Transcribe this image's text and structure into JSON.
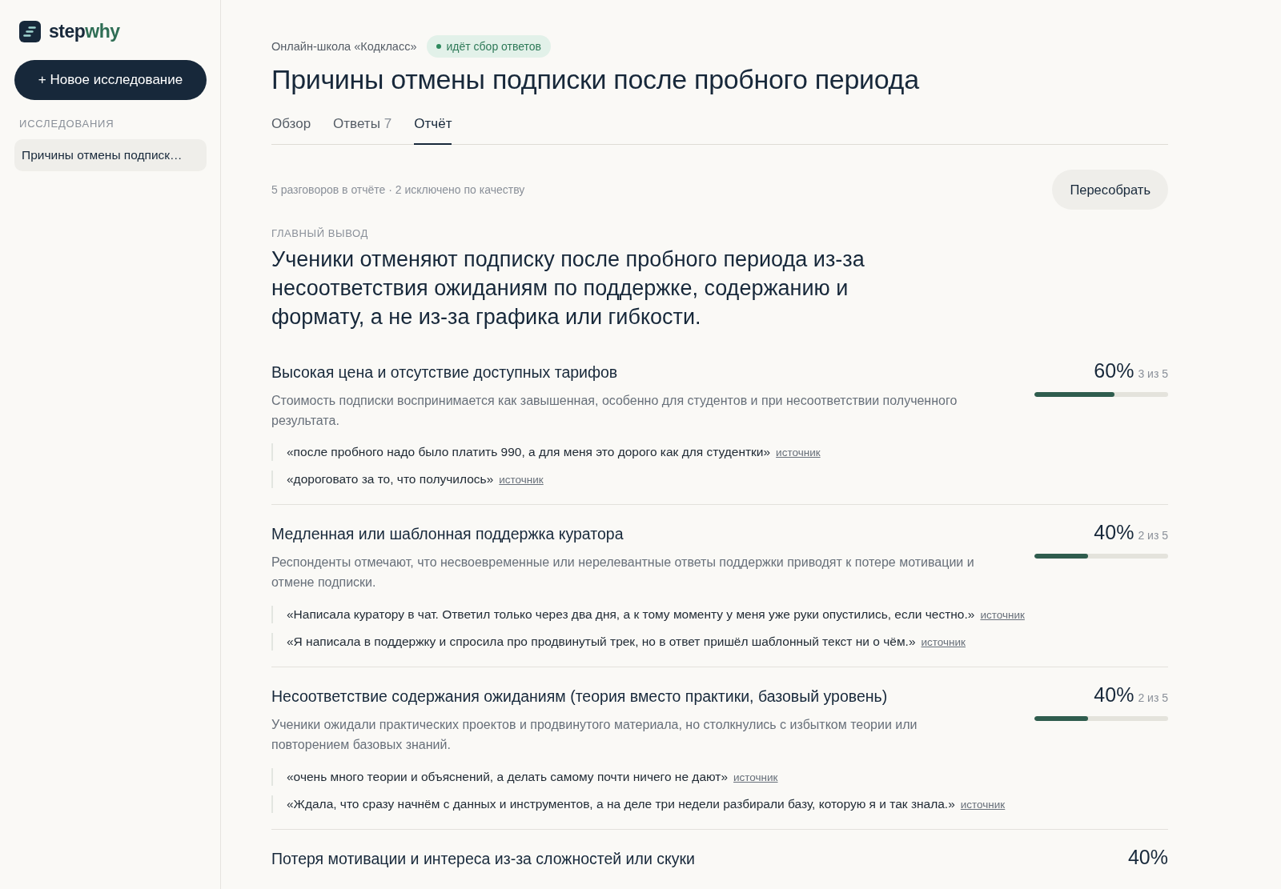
{
  "sidebar": {
    "logo": {
      "part_1": "step",
      "part_2": "why"
    },
    "new_button": "+ Новое исследование",
    "section_label": "ИССЛЕДОВАНИЯ",
    "items": [
      {
        "label": "Причины отмены подписк…",
        "selected": true
      }
    ]
  },
  "header": {
    "org": "Онлайн-школа «Кодкласс»",
    "status": "идёт сбор ответов",
    "title": "Причины отмены подписки после пробного периода"
  },
  "tabs": [
    {
      "label": "Обзор",
      "selected": false
    },
    {
      "label": "Ответы",
      "count": "7",
      "selected": false
    },
    {
      "label": "Отчёт",
      "selected": true
    }
  ],
  "report": {
    "summary": "5 разговоров в отчёте · 2 исключено по качеству",
    "rebuild_button": "Пересобрать",
    "main_label": "ГЛАВНЫЙ ВЫВОД",
    "main_conclusion": "Ученики отменяют подписку после пробного периода из-за несоответствия ожиданиям по поддержке, содержанию и формату, а не из-за графика или гибкости.",
    "findings": [
      {
        "title": "Высокая цена и отсутствие доступных тарифов",
        "description": "Стоимость подписки воспринимается как завышенная, особенно для студентов и при несоответствии полученного результата.",
        "percent": "60%",
        "count": "3 из 5",
        "level": 0.6,
        "quotes": [
          {
            "text": "«после пробного надо было платить 990, а для меня это дорого как для студентки»",
            "link": "источник"
          },
          {
            "text": "«дороговато за то, что получилось»",
            "link": "источник"
          }
        ]
      },
      {
        "title": "Медленная или шаблонная поддержка куратора",
        "description": "Респонденты отмечают, что несвоевременные или нерелевантные ответы поддержки приводят к потере мотивации и отмене подписки.",
        "percent": "40%",
        "count": "2 из 5",
        "level": 0.4,
        "quotes": [
          {
            "text": "«Написала куратору в чат. Ответил только через два дня, а к тому моменту у меня уже руки опустились, если честно.»",
            "link": "источник"
          },
          {
            "text": "«Я написала в поддержку и спросила про продвинутый трек, но в ответ пришёл шаблонный текст ни о чём.»",
            "link": "источник"
          }
        ]
      },
      {
        "title": "Несоответствие содержания ожиданиям (теория вместо практики, базовый уровень)",
        "description": "Ученики ожидали практических проектов и продвинутого материала, но столкнулись с избытком теории или повторением базовых знаний.",
        "percent": "40%",
        "count": "2 из 5",
        "level": 0.4,
        "quotes": [
          {
            "text": "«очень много теории и объяснений, а делать самому почти ничего не дают»",
            "link": "источник"
          },
          {
            "text": "«Ждала, что сразу начнём с данных и инструментов, а на деле три недели разбирали базу, которую я и так знала.»",
            "link": "источник"
          }
        ]
      },
      {
        "title": "Потеря мотивации и интереса из-за сложностей или скуки",
        "percent": "40%"
      }
    ]
  }
}
